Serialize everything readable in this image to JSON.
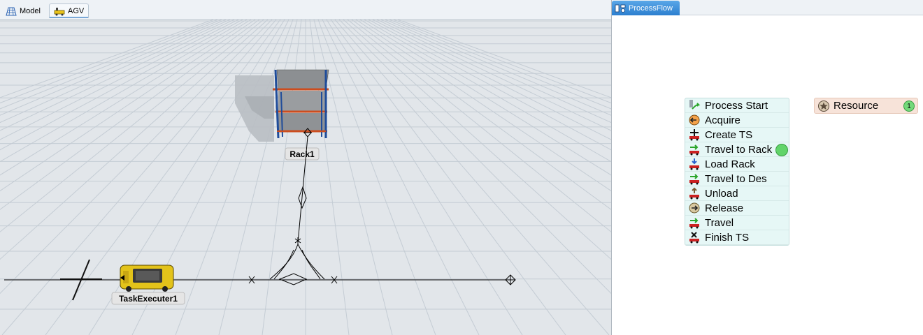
{
  "left_tabs": {
    "model_label": "Model",
    "agv_label": "AGV"
  },
  "scene": {
    "rack_label": "Rack1",
    "task_executer_label": "TaskExecuter1"
  },
  "right_tabs": {
    "processflow_label": "ProcessFlow"
  },
  "activities": [
    {
      "label": "Process Start",
      "icon": "process-start-icon"
    },
    {
      "label": "Acquire",
      "icon": "acquire-icon"
    },
    {
      "label": "Create TS",
      "icon": "create-ts-icon"
    },
    {
      "label": "Travel to Rack",
      "icon": "travel-icon"
    },
    {
      "label": "Load Rack",
      "icon": "load-icon"
    },
    {
      "label": "Travel to Des",
      "icon": "travel-icon"
    },
    {
      "label": "Unload",
      "icon": "unload-icon"
    },
    {
      "label": "Release",
      "icon": "release-icon"
    },
    {
      "label": "Travel",
      "icon": "travel-icon"
    },
    {
      "label": "Finish TS",
      "icon": "finish-ts-icon"
    }
  ],
  "resource": {
    "label": "Resource",
    "count": "1"
  },
  "colors": {
    "activity_bg": "#e6f7f6",
    "resource_bg": "#f7e3d9",
    "token": "#61d46a",
    "tab_active": "#2c7fcf"
  }
}
